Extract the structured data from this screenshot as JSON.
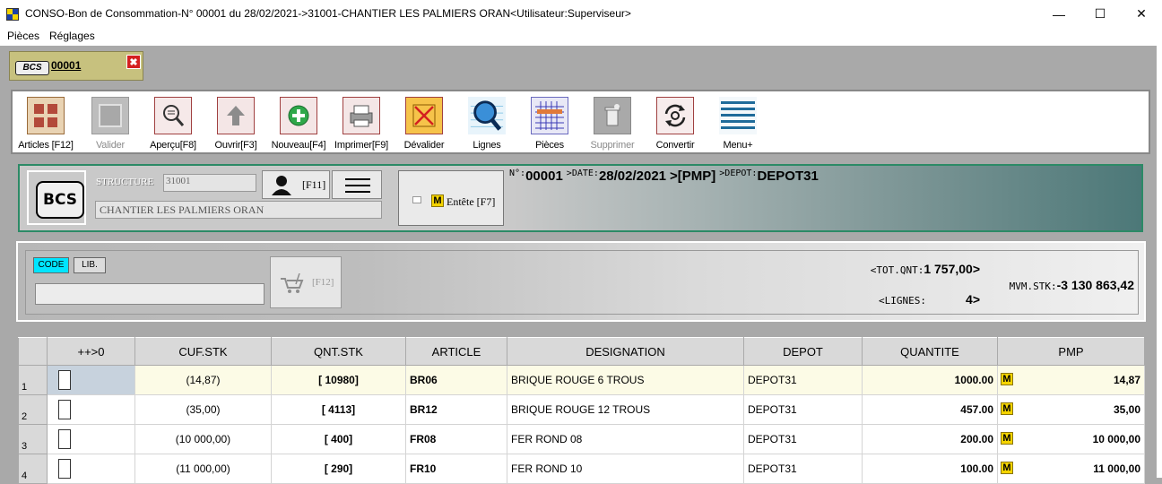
{
  "window": {
    "title": "CONSO-Bon de Consommation-N° 00001 du 28/02/2021->31001-CHANTIER LES PALMIERS ORAN<Utilisateur:Superviseur>",
    "minimize": "—",
    "maximize": "☐",
    "close": "✕"
  },
  "menu": {
    "items": [
      "Pièces",
      "Réglages"
    ]
  },
  "doc_tab": {
    "icon_text": "BCS",
    "label": "00001",
    "close": "✖"
  },
  "toolbar": {
    "items": [
      {
        "label": "Articles [F12]",
        "icon": "articles-icon"
      },
      {
        "label": "Valider",
        "icon": "validate-icon"
      },
      {
        "label": "Aperçu[F8]",
        "icon": "preview-icon"
      },
      {
        "label": "Ouvrir[F3]",
        "icon": "open-icon"
      },
      {
        "label": "Nouveau[F4]",
        "icon": "new-icon"
      },
      {
        "label": "Imprimer[F9]",
        "icon": "print-icon"
      },
      {
        "label": "Dévalider",
        "icon": "unvalidate-icon"
      },
      {
        "label": "Lignes",
        "icon": "lines-search-icon"
      },
      {
        "label": "Pièces",
        "icon": "documents-grid-icon"
      },
      {
        "label": "Supprimer",
        "icon": "delete-icon"
      },
      {
        "label": "Convertir",
        "icon": "convert-icon"
      },
      {
        "label": "Menu+",
        "icon": "menu-icon"
      }
    ]
  },
  "header": {
    "logo_text": "BCS",
    "structure_label": "STRUCTURE",
    "structure_code": "31001",
    "structure_name": "CHANTIER LES PALMIERS ORAN",
    "user_key": "[F11]",
    "entete_label": "Entête [F7]",
    "entete_badge": "M",
    "no_label": "N°",
    "no_value": "00001",
    "date_label": ">DATE",
    "date_value": "28/02/2021",
    "method_value": ">[PMP]",
    "depot_label": ">DEPOT",
    "depot_value": "DEPOT31"
  },
  "search": {
    "mode_code": "CODE",
    "mode_lib": "LIB.",
    "input_value": "",
    "cart_key": "[F12]",
    "tot_qnt_label": "<TOT.QNT",
    "tot_qnt_value": "1 757,00>",
    "lignes_label": "<LIGNES",
    "lignes_value": "4>",
    "mvm_stk_label": "MVM.STK",
    "mvm_stk_value": "-3 130 863,42"
  },
  "grid": {
    "columns": [
      "",
      "++>0",
      "CUF.STK",
      "QNT.STK",
      "ARTICLE",
      "DESIGNATION",
      "DEPOT",
      "QUANTITE",
      "PMP"
    ],
    "rows": [
      {
        "n": "1",
        "cuf": "(14,87)",
        "qnt_stk": "[ 10980]",
        "article": "BR06",
        "designation": "BRIQUE ROUGE 6 TROUS",
        "depot": "DEPOT31",
        "quantite": "1000.00",
        "badge": "M",
        "pmp": "14,87"
      },
      {
        "n": "2",
        "cuf": "(35,00)",
        "qnt_stk": "[ 4113]",
        "article": "BR12",
        "designation": "BRIQUE ROUGE 12 TROUS",
        "depot": "DEPOT31",
        "quantite": "457.00",
        "badge": "M",
        "pmp": "35,00"
      },
      {
        "n": "3",
        "cuf": "(10 000,00)",
        "qnt_stk": "[ 400]",
        "article": "FR08",
        "designation": "FER ROND 08",
        "depot": "DEPOT31",
        "quantite": "200.00",
        "badge": "M",
        "pmp": "10 000,00"
      },
      {
        "n": "4",
        "cuf": "(11 000,00)",
        "qnt_stk": "[ 290]",
        "article": "FR10",
        "designation": "FER ROND 10",
        "depot": "DEPOT31",
        "quantite": "100.00",
        "badge": "M",
        "pmp": "11 000,00"
      }
    ]
  },
  "colors": {
    "accent_yellow": "#f5d400",
    "header_border": "#2c8a66",
    "code_active": "#00e5ff",
    "close_red": "#d42020"
  }
}
